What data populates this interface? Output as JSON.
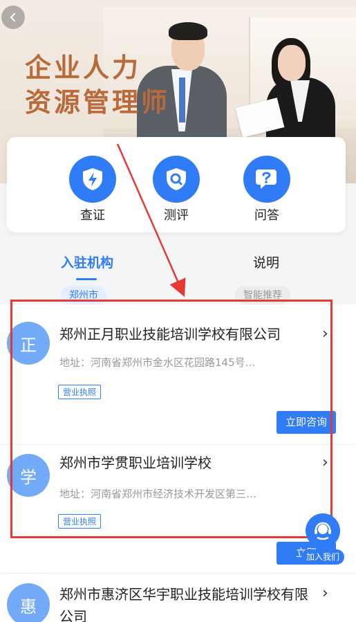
{
  "banner": {
    "line1": "企业人力",
    "line2": "资源管理师"
  },
  "actions": [
    {
      "label": "查证",
      "icon": "shield-lightning-icon"
    },
    {
      "label": "测评",
      "icon": "shield-search-icon"
    },
    {
      "label": "问答",
      "icon": "question-bubble-icon"
    }
  ],
  "tabs": {
    "active": "入驻机构",
    "inactive": "说明"
  },
  "filters": {
    "city": "郑州市",
    "sort": "智能推荐"
  },
  "orgs": [
    {
      "avatar": "正",
      "name": "郑州正月职业技能培训学校有限公司",
      "address": "地址：河南省郑州市金水区花园路145号…",
      "badge": "营业执照",
      "consult": "立即咨询"
    },
    {
      "avatar": "学",
      "name": "郑州市学贯职业培训学校",
      "address": "地址：河南省郑州市经济技术开发区第三…",
      "badge": "营业执照",
      "consult": "立即"
    },
    {
      "avatar": "惠",
      "name": "郑州市惠济区华宇职业技能培训学校有限公司"
    }
  ],
  "support": {
    "label": "加入我们"
  },
  "colors": {
    "accent": "#2f7cf6",
    "annotation": "#e53935",
    "headline": "#b86a3b"
  }
}
